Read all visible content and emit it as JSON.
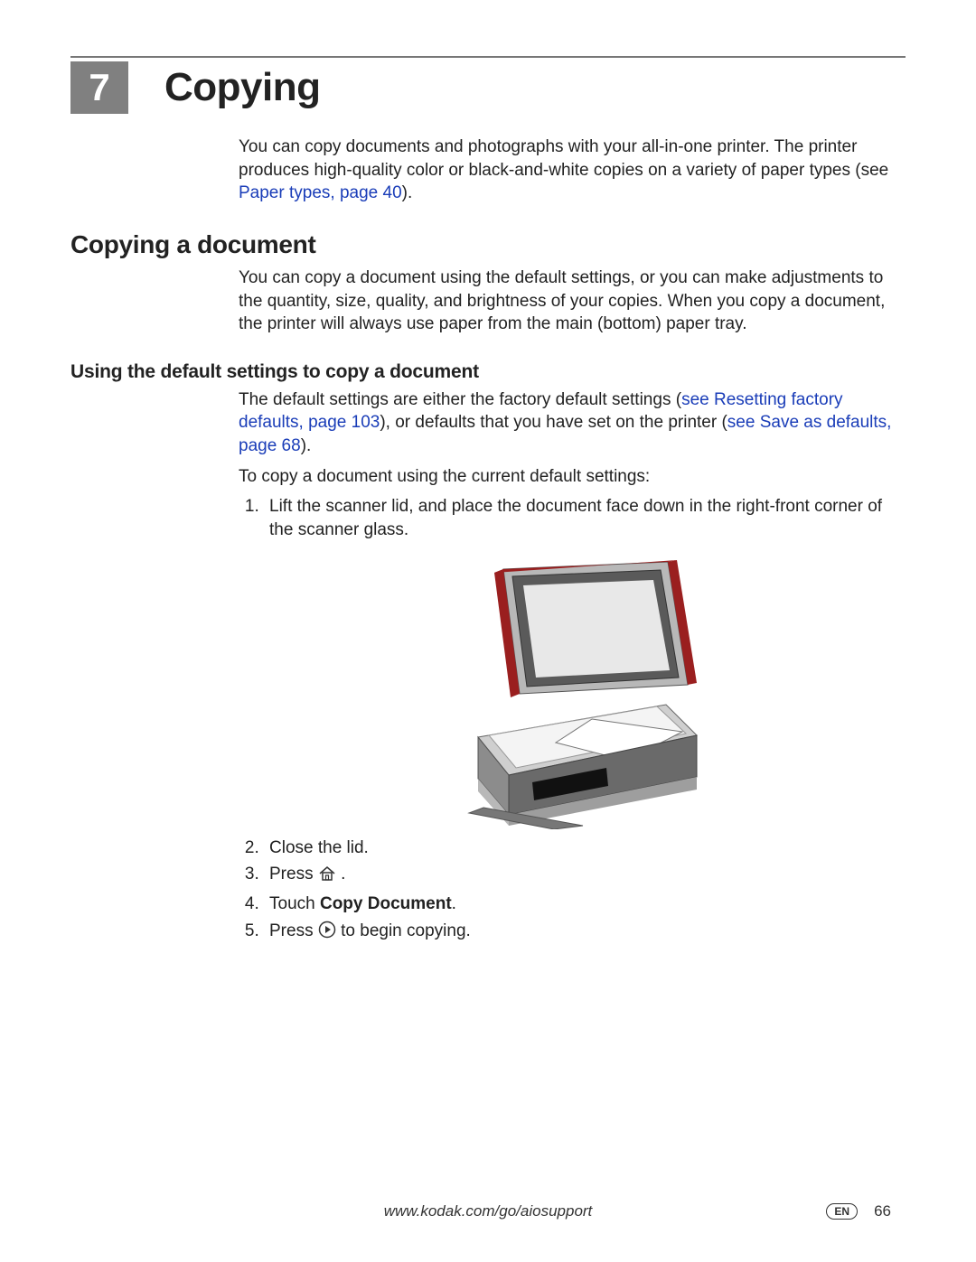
{
  "chapter": {
    "number": "7",
    "title": "Copying"
  },
  "intro": {
    "text_a": "You can copy documents and photographs with your all-in-one printer. The printer produces high-quality color or black-and-white copies on a variety of paper types (see ",
    "link": "Paper types, page 40",
    "text_b": ")."
  },
  "section1": {
    "heading": "Copying a document",
    "para": "You can copy a document using the default settings, or you can make adjustments to the quantity, size, quality, and brightness of your copies. When you copy a document, the printer will always use paper from the main (bottom) paper tray."
  },
  "section2": {
    "heading": "Using the default settings to copy a document",
    "para1_a": "The default settings are either the factory default settings (",
    "para1_link1": "see Resetting factory defaults, page 103",
    "para1_b": "), or defaults that you have set on the printer (",
    "para1_link2": "see Save as defaults, page 68",
    "para1_c": ").",
    "para2": "To copy a document using the current default settings:",
    "steps": {
      "s1": "Lift the scanner lid, and place the document face down in the right-front corner of the scanner glass.",
      "s2": "Close the lid.",
      "s3_a": "Press ",
      "s3_b": ".",
      "s4_a": "Touch ",
      "s4_bold": "Copy Document",
      "s4_b": ".",
      "s5_a": "Press ",
      "s5_b": " to begin copying."
    }
  },
  "icons": {
    "home": "home-icon",
    "play": "play-circle-icon"
  },
  "footer": {
    "url": "www.kodak.com/go/aiosupport",
    "lang": "EN",
    "page": "66"
  }
}
